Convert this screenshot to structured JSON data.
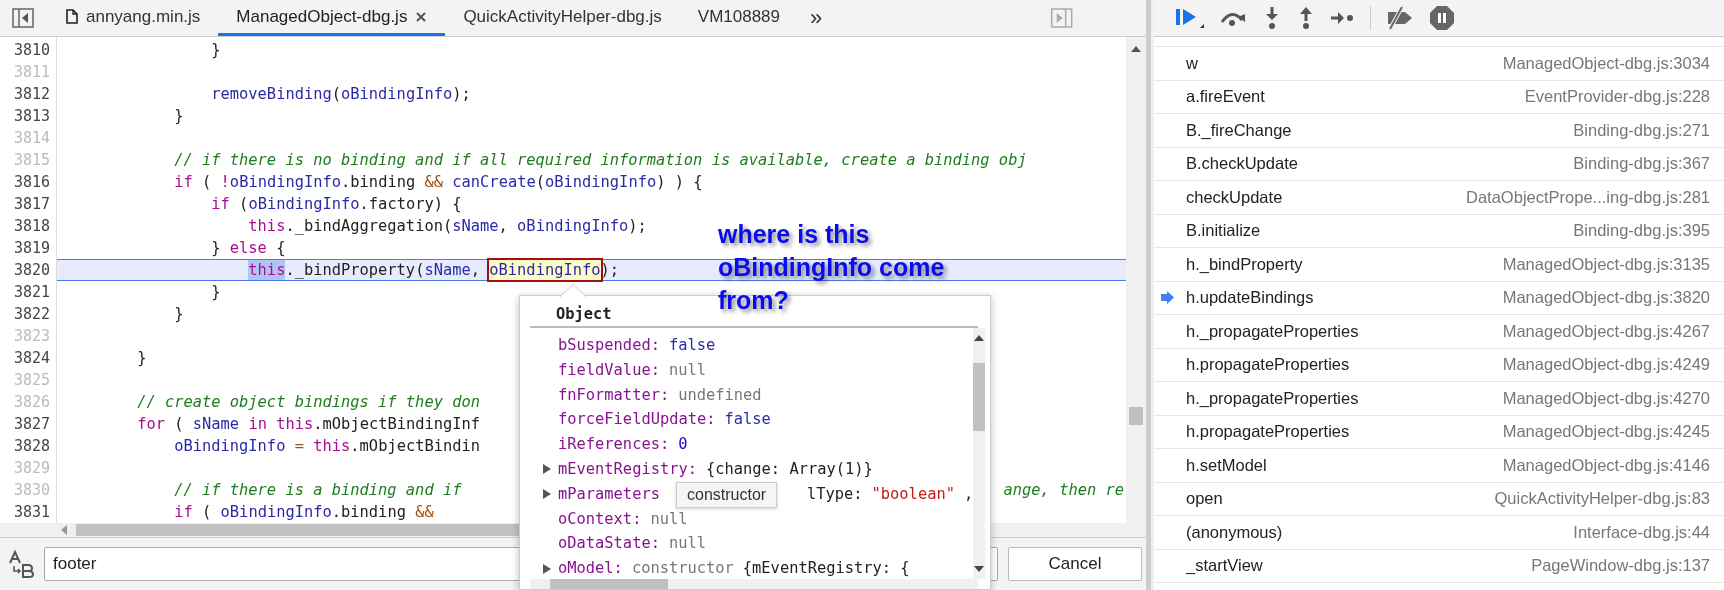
{
  "editor_tabs": [
    {
      "label": "annyang.min.js",
      "kind": "file",
      "selected": false,
      "closable": false
    },
    {
      "label": "ManagedObject-dbg.js",
      "kind": "plain",
      "selected": true,
      "closable": true
    },
    {
      "label": "QuickActivityHelper-dbg.js",
      "kind": "plain",
      "selected": false,
      "closable": false
    },
    {
      "label": "VM108889",
      "kind": "plain",
      "selected": false,
      "closable": false
    }
  ],
  "tabs_overflow": "»",
  "code_lines": [
    {
      "number": "3810",
      "executable": true,
      "current": false,
      "tokens": [
        {
          "text": "                }",
          "kind": "plain"
        }
      ]
    },
    {
      "number": "3811",
      "executable": false,
      "current": false
    },
    {
      "number": "3812",
      "executable": true,
      "current": false,
      "tokens": [
        {
          "text": "                removeBinding",
          "kind": "var"
        },
        {
          "text": "(",
          "kind": "plain"
        },
        {
          "text": "oBindingInfo",
          "kind": "var"
        },
        {
          "text": ");",
          "kind": "plain"
        }
      ]
    },
    {
      "number": "3813",
      "executable": true,
      "current": false,
      "tokens": [
        {
          "text": "            }",
          "kind": "plain"
        }
      ]
    },
    {
      "number": "3814",
      "executable": false,
      "current": false
    },
    {
      "number": "3815",
      "executable": false,
      "current": false,
      "tokens": [
        {
          "text": "            // if there is no binding and if all required information is available, create a binding obj",
          "kind": "comment"
        }
      ]
    },
    {
      "number": "3816",
      "executable": true,
      "current": false,
      "tokens": [
        {
          "text": "            if",
          "kind": "kw"
        },
        {
          "text": " ( ",
          "kind": "plain"
        },
        {
          "text": "!",
          "kind": "kw"
        },
        {
          "text": "oBindingInfo",
          "kind": "var"
        },
        {
          "text": ".binding ",
          "kind": "plain"
        },
        {
          "text": "&&",
          "kind": "op"
        },
        {
          "text": " canCreate",
          "kind": "var"
        },
        {
          "text": "(",
          "kind": "plain"
        },
        {
          "text": "oBindingInfo",
          "kind": "var"
        },
        {
          "text": ") ) {",
          "kind": "plain"
        }
      ]
    },
    {
      "number": "3817",
      "executable": true,
      "current": false,
      "tokens": [
        {
          "text": "                if",
          "kind": "kw"
        },
        {
          "text": " (",
          "kind": "plain"
        },
        {
          "text": "oBindingInfo",
          "kind": "var"
        },
        {
          "text": ".factory) {",
          "kind": "plain"
        }
      ]
    },
    {
      "number": "3818",
      "executable": true,
      "current": false,
      "tokens": [
        {
          "text": "                    this",
          "kind": "kw"
        },
        {
          "text": "._bindAggregation(",
          "kind": "plain"
        },
        {
          "text": "sName",
          "kind": "var"
        },
        {
          "text": ", ",
          "kind": "plain"
        },
        {
          "text": "oBindingInfo",
          "kind": "var"
        },
        {
          "text": ");",
          "kind": "plain"
        }
      ]
    },
    {
      "number": "3819",
      "executable": true,
      "current": false,
      "tokens": [
        {
          "text": "                } ",
          "kind": "plain"
        },
        {
          "text": "else",
          "kind": "kw"
        },
        {
          "text": " {",
          "kind": "plain"
        }
      ]
    },
    {
      "number": "3820",
      "executable": true,
      "current": true,
      "tokens": [
        {
          "text": "                    this",
          "kind": "selected-kw"
        },
        {
          "text": "._bindProperty(",
          "kind": "plain"
        },
        {
          "text": "sName",
          "kind": "var"
        },
        {
          "text": ", ",
          "kind": "plain"
        },
        {
          "text": "oBindingInfo",
          "kind": "hovered-var"
        },
        {
          "text": ");",
          "kind": "plain"
        }
      ]
    },
    {
      "number": "3821",
      "executable": true,
      "current": false,
      "tokens": [
        {
          "text": "                }",
          "kind": "plain"
        }
      ]
    },
    {
      "number": "3822",
      "executable": true,
      "current": false,
      "tokens": [
        {
          "text": "            }",
          "kind": "plain"
        }
      ]
    },
    {
      "number": "3823",
      "executable": false,
      "current": false
    },
    {
      "number": "3824",
      "executable": true,
      "current": false,
      "tokens": [
        {
          "text": "        }",
          "kind": "plain"
        }
      ]
    },
    {
      "number": "3825",
      "executable": false,
      "current": false
    },
    {
      "number": "3826",
      "executable": false,
      "current": false,
      "tokens": [
        {
          "text": "        // create object bindings if they don",
          "kind": "comment"
        }
      ]
    },
    {
      "number": "3827",
      "executable": true,
      "current": false,
      "tokens": [
        {
          "text": "        for",
          "kind": "kw"
        },
        {
          "text": " ( ",
          "kind": "plain"
        },
        {
          "text": "sName",
          "kind": "var"
        },
        {
          "text": " in",
          "kind": "kw"
        },
        {
          "text": " this",
          "kind": "kw"
        },
        {
          "text": ".mObjectBindingInf",
          "kind": "plain"
        }
      ]
    },
    {
      "number": "3828",
      "executable": true,
      "current": false,
      "tokens": [
        {
          "text": "            oBindingInfo",
          "kind": "var"
        },
        {
          "text": " =",
          "kind": "op"
        },
        {
          "text": " this",
          "kind": "kw"
        },
        {
          "text": ".mObjectBindin",
          "kind": "plain"
        }
      ]
    },
    {
      "number": "3829",
      "executable": false,
      "current": false
    },
    {
      "number": "3830",
      "executable": false,
      "current": false,
      "tokens": [
        {
          "text": "            // if there is a binding and if",
          "kind": "comment"
        }
      ],
      "tail": {
        "text": "ange, then re",
        "kind": "comment"
      }
    },
    {
      "number": "3831",
      "executable": true,
      "current": false,
      "tokens": [
        {
          "text": "            if",
          "kind": "kw"
        },
        {
          "text": " ( ",
          "kind": "plain"
        },
        {
          "text": "oBindingInfo",
          "kind": "var"
        },
        {
          "text": ".binding ",
          "kind": "plain"
        },
        {
          "text": "&&",
          "kind": "op"
        }
      ]
    }
  ],
  "annotation": "where is this oBindingInfo come from?",
  "object_popup": {
    "title": "Object",
    "properties": [
      {
        "key": "bSuspended:",
        "expandable": false,
        "value": [
          {
            "text": "false",
            "kind": "literal"
          }
        ]
      },
      {
        "key": "fieldValue:",
        "expandable": false,
        "value": [
          {
            "text": "null",
            "kind": "null"
          }
        ]
      },
      {
        "key": "fnFormatter:",
        "expandable": false,
        "value": [
          {
            "text": "undefined",
            "kind": "null"
          }
        ]
      },
      {
        "key": "forceFieldUpdate:",
        "expandable": false,
        "value": [
          {
            "text": "false",
            "kind": "literal"
          }
        ]
      },
      {
        "key": "iReferences:",
        "expandable": false,
        "value": [
          {
            "text": "0",
            "kind": "number"
          }
        ]
      },
      {
        "key": "mEventRegistry:",
        "expandable": true,
        "value": [
          {
            "text": "{change: Array(1)}",
            "kind": "plain"
          }
        ]
      },
      {
        "key": "mParameters",
        "expandable": true,
        "partly_hidden": true,
        "value": [
          {
            "text": "lType:",
            "kind": "plain"
          },
          {
            "text": "\"boolean\"",
            "kind": "string"
          },
          {
            "text": ",",
            "kind": "plain"
          }
        ]
      },
      {
        "key": "oContext:",
        "expandable": false,
        "value": [
          {
            "text": "null",
            "kind": "null"
          }
        ]
      },
      {
        "key": "oDataState:",
        "expandable": false,
        "value": [
          {
            "text": "null",
            "kind": "null"
          }
        ]
      },
      {
        "key": "oModel:",
        "expandable": true,
        "value": [
          {
            "text": "constructor",
            "kind": "null"
          },
          {
            "text": "{mEventRegistry: {",
            "kind": "plain"
          }
        ]
      }
    ],
    "tooltip": "constructor"
  },
  "search": {
    "value": "footer",
    "cancel": "Cancel"
  },
  "call_stack": [
    {
      "name": "w",
      "location": "ManagedObject-dbg.js:3034",
      "current": false
    },
    {
      "name": "a.fireEvent",
      "location": "EventProvider-dbg.js:228",
      "current": false
    },
    {
      "name": "B._fireChange",
      "location": "Binding-dbg.js:271",
      "current": false
    },
    {
      "name": "B.checkUpdate",
      "location": "Binding-dbg.js:367",
      "current": false
    },
    {
      "name": "checkUpdate",
      "location": "DataObjectPrope...ing-dbg.js:281",
      "current": false
    },
    {
      "name": "B.initialize",
      "location": "Binding-dbg.js:395",
      "current": false
    },
    {
      "name": "h._bindProperty",
      "location": "ManagedObject-dbg.js:3135",
      "current": false
    },
    {
      "name": "h.updateBindings",
      "location": "ManagedObject-dbg.js:3820",
      "current": true
    },
    {
      "name": "h._propagateProperties",
      "location": "ManagedObject-dbg.js:4267",
      "current": false
    },
    {
      "name": "h.propagateProperties",
      "location": "ManagedObject-dbg.js:4249",
      "current": false
    },
    {
      "name": "h._propagateProperties",
      "location": "ManagedObject-dbg.js:4270",
      "current": false
    },
    {
      "name": "h.propagateProperties",
      "location": "ManagedObject-dbg.js:4245",
      "current": false
    },
    {
      "name": "h.setModel",
      "location": "ManagedObject-dbg.js:4146",
      "current": false
    },
    {
      "name": "open",
      "location": "QuickActivityHelper-dbg.js:83",
      "current": false
    },
    {
      "name": "(anonymous)",
      "location": "Interface-dbg.js:44",
      "current": false
    },
    {
      "name": "_startView",
      "location": "PageWindow-dbg.js:137",
      "current": false
    }
  ]
}
